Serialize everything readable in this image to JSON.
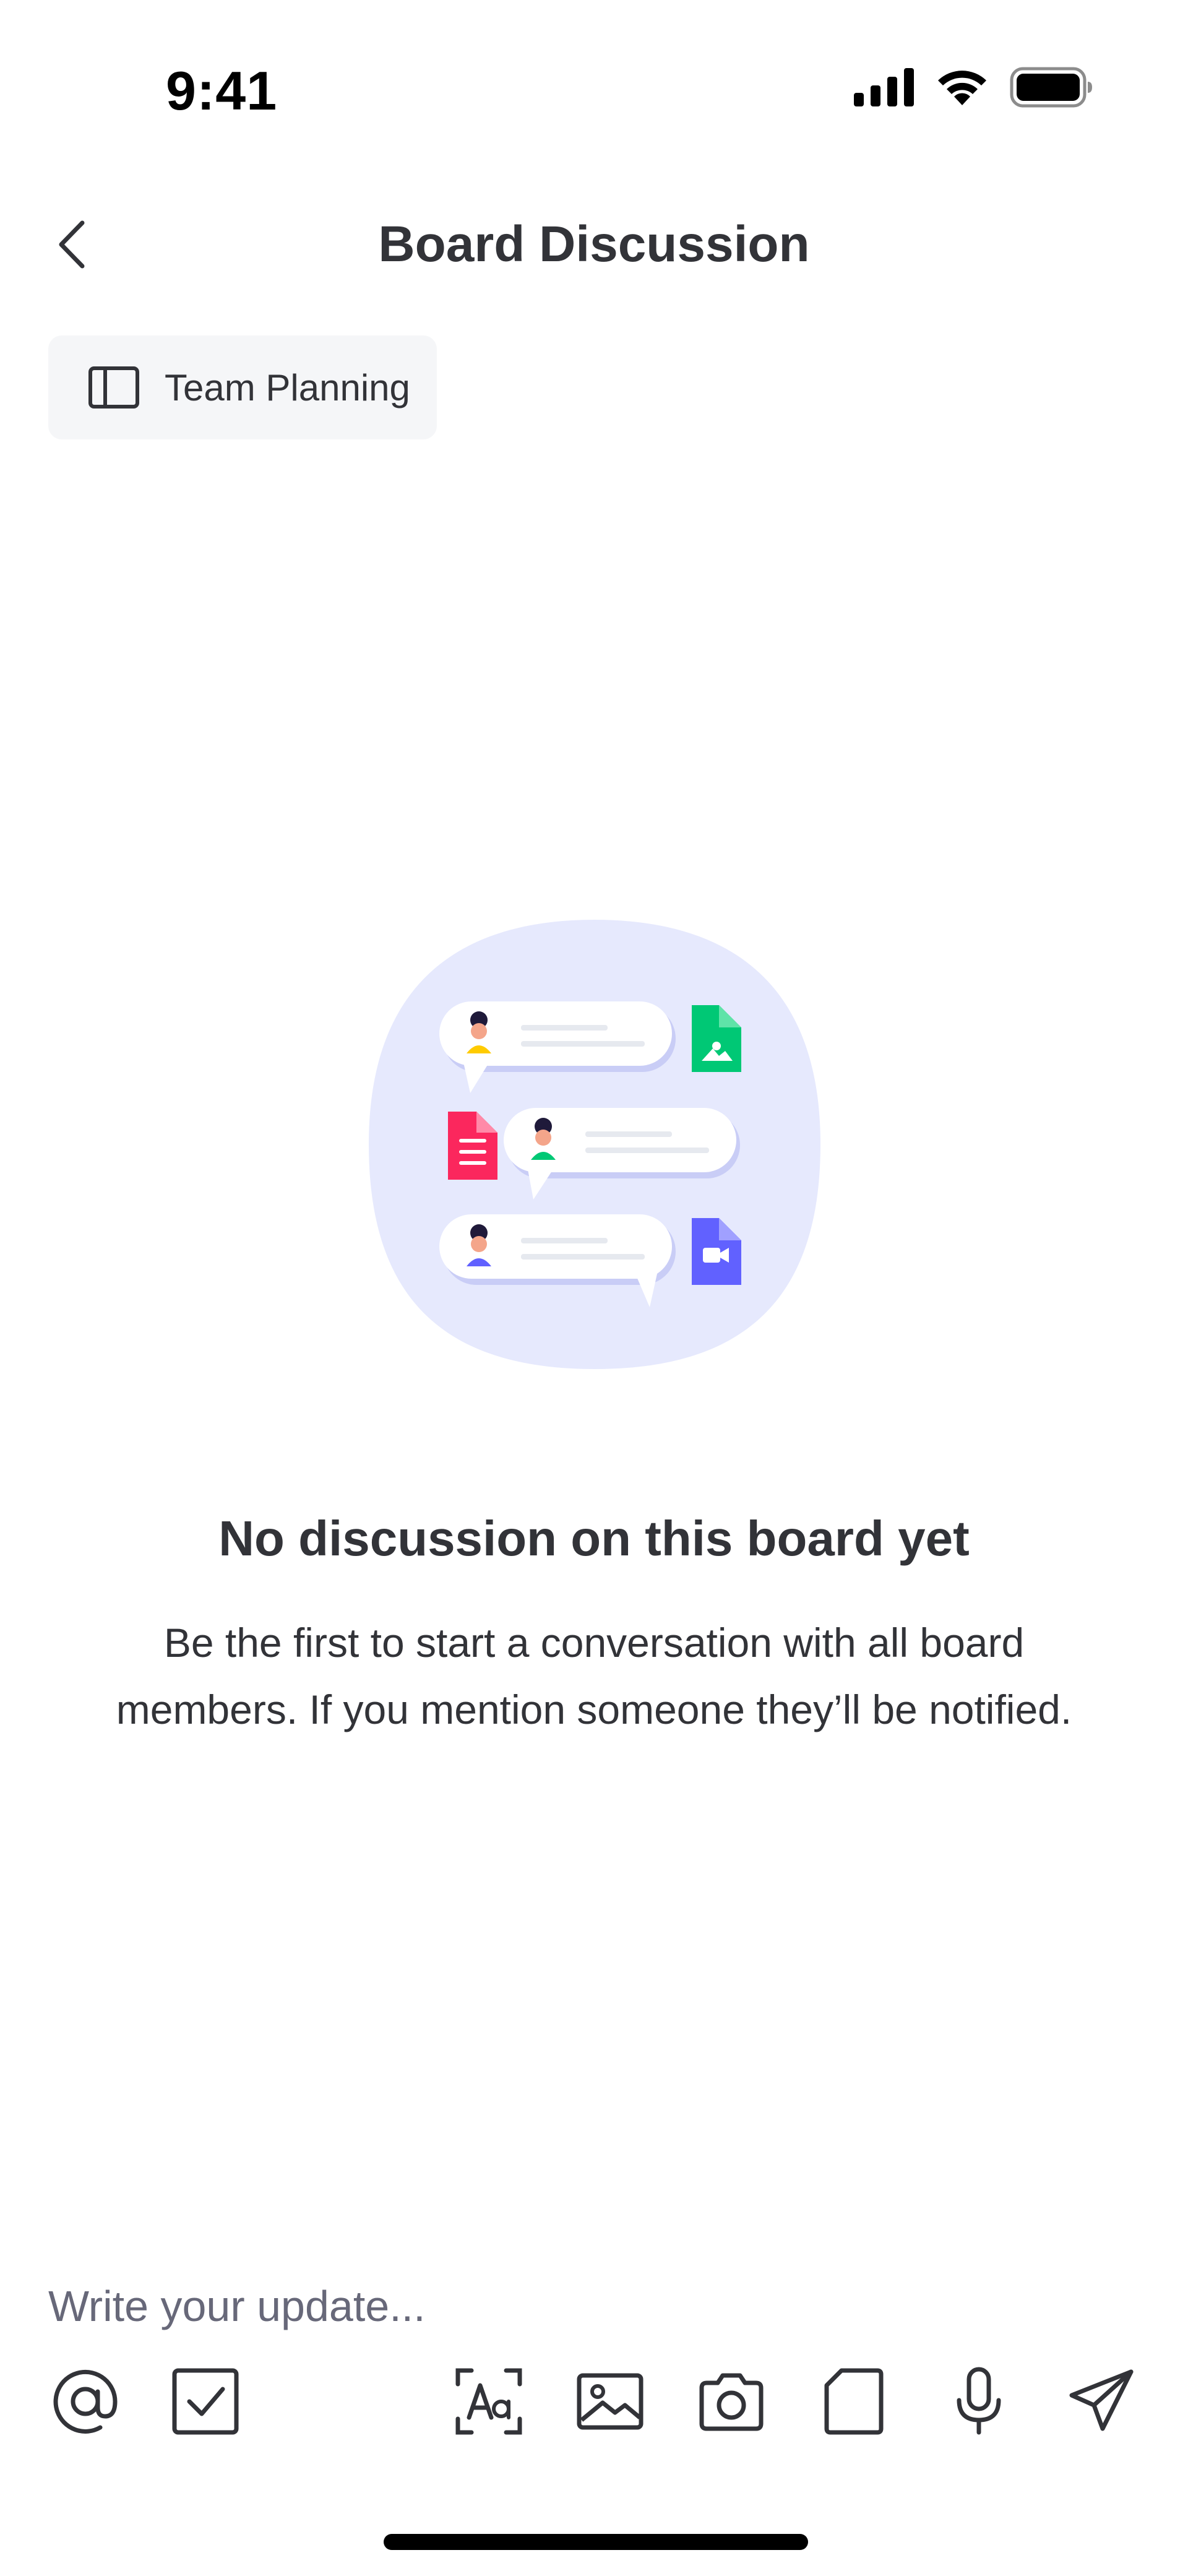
{
  "status_bar": {
    "time": "9:41",
    "signal_icon": "cellular-signal-icon",
    "wifi_icon": "wifi-icon",
    "battery_icon": "battery-icon"
  },
  "header": {
    "back_icon": "chevron-left-icon",
    "title": "Board Discussion"
  },
  "board_chip": {
    "icon": "board-icon",
    "label": "Team Planning"
  },
  "empty_state": {
    "illustration": "chat-bubbles-illustration",
    "title": "No discussion on this board yet",
    "description": "Be the first to start a conversation with all board members. If you mention someone they’ll be notified."
  },
  "composer": {
    "placeholder": "Write your update...",
    "tools": [
      "mention-icon",
      "checklist-icon",
      "text-format-icon",
      "image-icon",
      "camera-icon",
      "file-icon",
      "microphone-icon",
      "send-icon"
    ]
  },
  "colors": {
    "text_primary": "#323338",
    "text_secondary": "#676879",
    "chip_bg": "#f5f6f8",
    "illustration_bg": "#e6e9fd",
    "accent_green": "#00c875",
    "accent_red": "#fb275d",
    "accent_purple": "#6161ff"
  }
}
